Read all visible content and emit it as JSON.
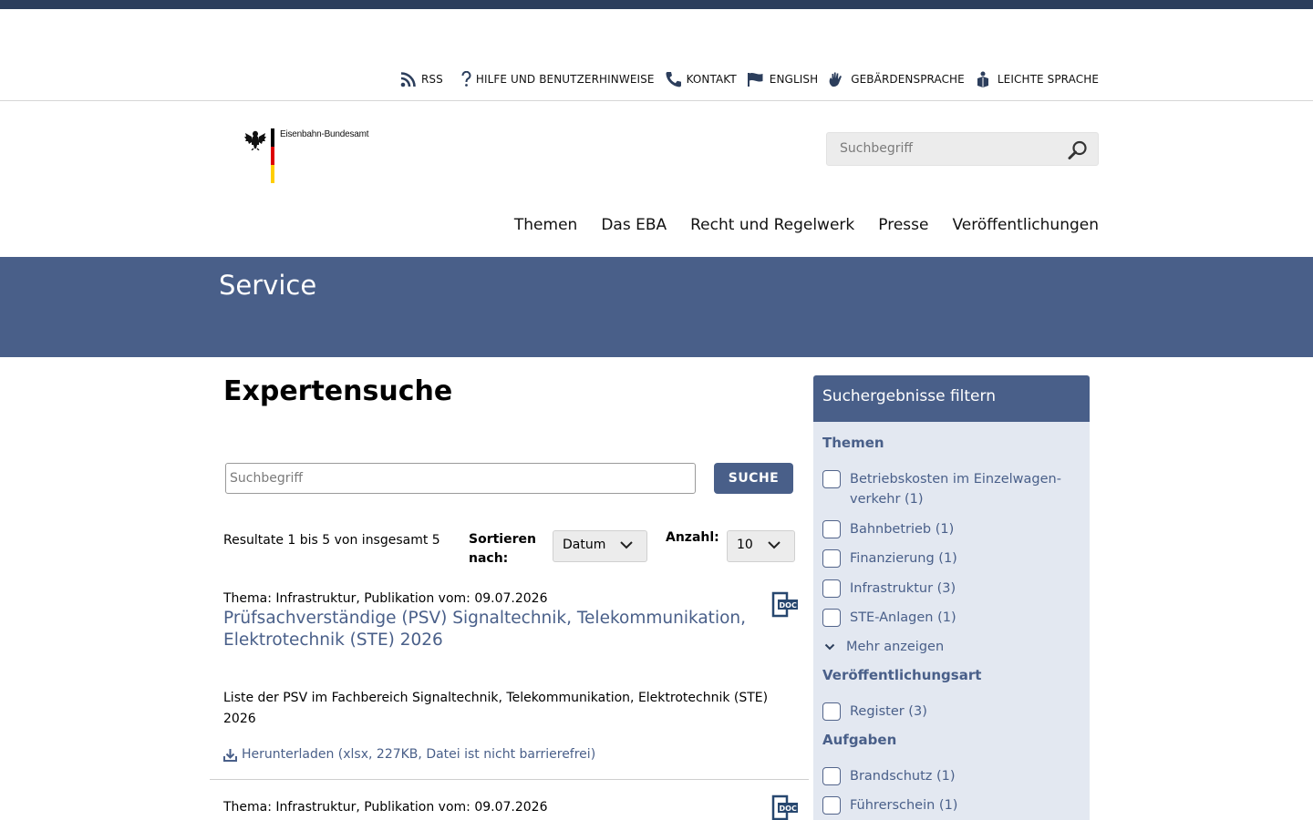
{
  "meta_nav": {
    "rss": "RSS",
    "help": "HILFE UND BENUTZERHINWEISE",
    "contact": "KONTAKT",
    "english": "ENGLISH",
    "sign_language": "GEBÄRDENSPRACHE",
    "easy_language": "LEICHTE SPRACHE"
  },
  "logo": {
    "name": "Eisenbahn-Bundesamt"
  },
  "header_search": {
    "placeholder": "Suchbegriff"
  },
  "main_nav": [
    "Themen",
    "Das EBA",
    "Recht und Regelwerk",
    "Presse",
    "Veröffentlichungen"
  ],
  "banner": {
    "title": "Service"
  },
  "page": {
    "heading": "Expertensuche",
    "search_placeholder": "Suchbegriff",
    "search_button": "SUCHE",
    "results_info": "Resultate 1 bis 5 von insgesamt 5",
    "sort_label": "Sortieren nach:",
    "sort_value": "Datum",
    "count_label": "Anzahl:",
    "count_value": "10"
  },
  "results": [
    {
      "meta": "Thema: Infrastruktur, Publikation vom: 09.07.2026",
      "title": "Prüfsachverständige (PSV) Signaltechnik, Telekommunikation, Elektrotechnik (STE) 2026",
      "description": "Liste der PSV im Fachbereich Signaltechnik, Telekommunikation, Elektrotechnik (STE) 2026",
      "download": "Herunterladen (xlsx, 227KB, Datei ist nicht barrierefrei)"
    },
    {
      "meta": "Thema: Infrastruktur, Publikation vom: 09.07.2026"
    }
  ],
  "filter": {
    "title": "Suchergebnisse filtern",
    "groups": [
      {
        "name": "Themen",
        "items": [
          "Betriebskosten im Einzelwagen-verkehr (1)",
          "Bahnbetrieb (1)",
          "Finanzierung (1)",
          "Infrastruktur (3)",
          "STE-Anlagen (1)"
        ],
        "more": "Mehr anzeigen"
      },
      {
        "name": "Veröffentlichungsart",
        "items": [
          "Register (3)"
        ]
      },
      {
        "name": "Aufgaben",
        "items": [
          "Brandschutz (1)",
          "Führerschein (1)"
        ]
      }
    ]
  },
  "colors": {
    "brand": "#495f89",
    "topbar": "#2c3e5c",
    "filter_bg": "#e3e8f1"
  }
}
